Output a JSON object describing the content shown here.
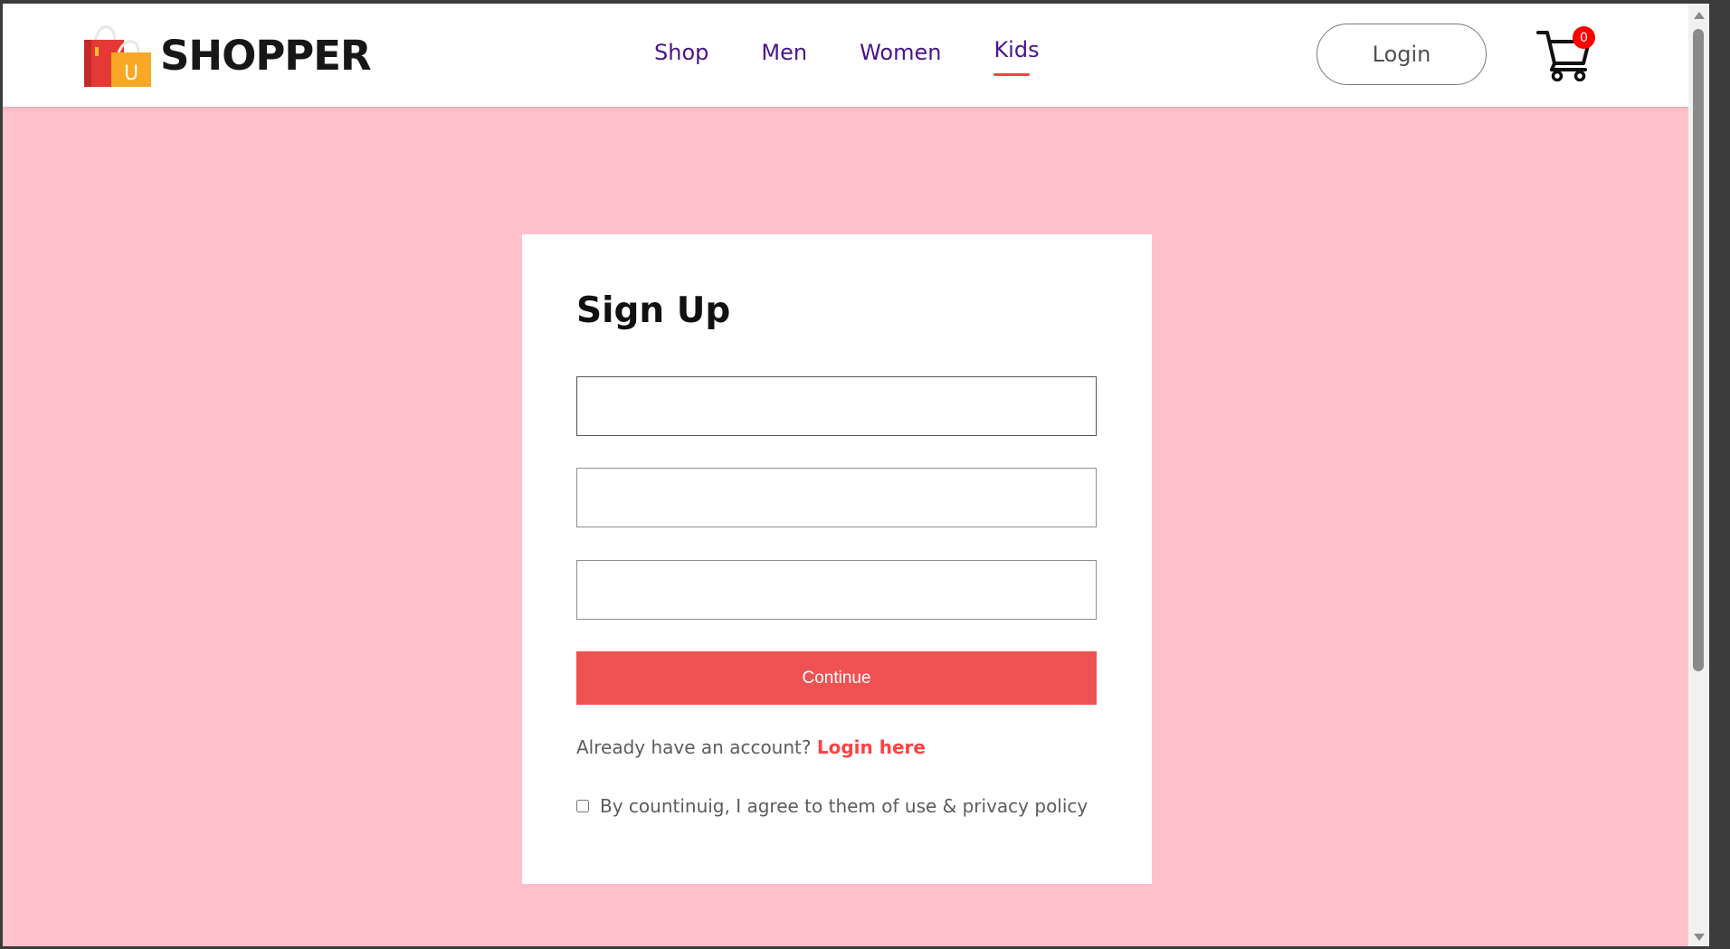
{
  "brand": {
    "name": "SHOPPER",
    "logo_letter": "U"
  },
  "nav": {
    "items": [
      {
        "label": "Shop",
        "active": false
      },
      {
        "label": "Men",
        "active": false
      },
      {
        "label": "Women",
        "active": false
      },
      {
        "label": "Kids",
        "active": true
      }
    ]
  },
  "header": {
    "login_label": "Login",
    "cart_count": "0"
  },
  "signup": {
    "title": "Sign Up",
    "fields": [
      {
        "value": "",
        "placeholder": ""
      },
      {
        "value": "",
        "placeholder": ""
      },
      {
        "value": "",
        "placeholder": ""
      }
    ],
    "continue_label": "Continue",
    "login_prompt": "Already have an account?",
    "login_link": "Login here",
    "agree_text": "By countinuig, I agree to them of use & privacy policy",
    "agree_checked": false
  },
  "colors": {
    "background": "#fec0cb",
    "accent": "#ff4141",
    "button": "#ef5252",
    "nav_text": "#4a148c"
  },
  "icons": {
    "logo": "shopping-bag-icon",
    "cart": "cart-icon"
  }
}
